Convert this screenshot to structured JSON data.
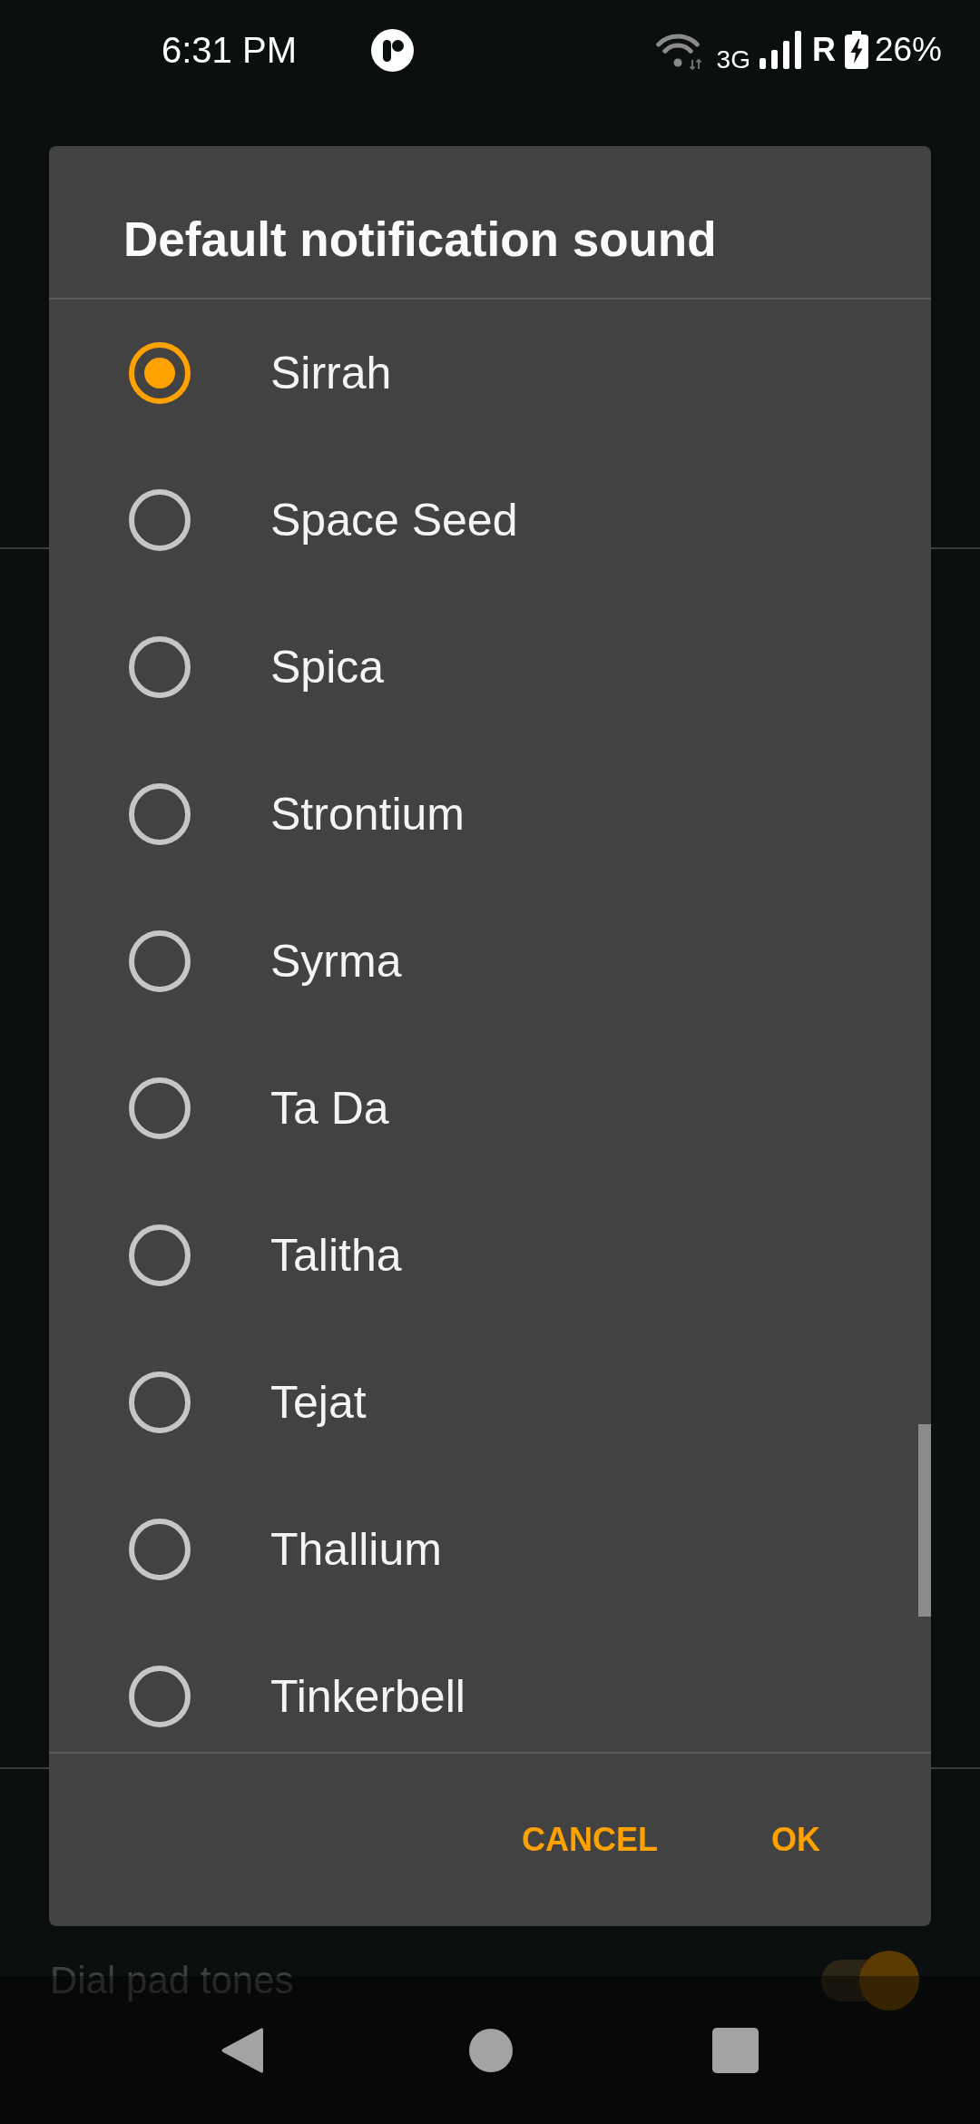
{
  "status_bar": {
    "time": "6:31 PM",
    "network_type": "3G",
    "roaming": "R",
    "battery": "26%",
    "charging": true
  },
  "background": {
    "settings_item": {
      "label": "Dial pad tones",
      "on": true
    }
  },
  "dialog": {
    "title": "Default notification sound",
    "options": [
      {
        "label": "Sirrah",
        "selected": true
      },
      {
        "label": "Space Seed",
        "selected": false
      },
      {
        "label": "Spica",
        "selected": false
      },
      {
        "label": "Strontium",
        "selected": false
      },
      {
        "label": "Syrma",
        "selected": false
      },
      {
        "label": "Ta Da",
        "selected": false
      },
      {
        "label": "Talitha",
        "selected": false
      },
      {
        "label": "Tejat",
        "selected": false
      },
      {
        "label": "Thallium",
        "selected": false
      },
      {
        "label": "Tinkerbell",
        "selected": false
      }
    ],
    "buttons": [
      {
        "label": "CANCEL"
      },
      {
        "label": "OK"
      }
    ]
  }
}
